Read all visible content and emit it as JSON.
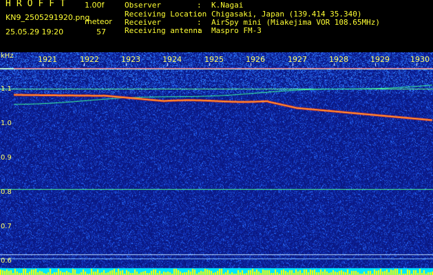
{
  "header": {
    "app_title": "HROFFT",
    "version": "1.00f",
    "filename": "KN9_2505291920.png",
    "meteor_label": "meteor",
    "datetime": "25.05.29 19:20",
    "meteor_count": "57",
    "fields": [
      {
        "label": "Observer",
        "value": "K.Nagai"
      },
      {
        "label": "Receiving Location",
        "value": "Chigasaki, Japan (139.414 35.340)"
      },
      {
        "label": "Receiver",
        "value": "AirSpy mini (Miakejima VOR 108.65MHz)"
      },
      {
        "label": "Receiving antenna",
        "value": "Maspro FM-3"
      }
    ]
  },
  "spectrogram": {
    "unit": "kHz",
    "time_ticks": [
      "1921",
      "1922",
      "1923",
      "1924",
      "1925",
      "1926",
      "1927",
      "1928",
      "1929",
      "1930"
    ],
    "freq_ticks": [
      "1.1",
      "1.0",
      "0.9",
      "0.8",
      "0.7",
      "0.6"
    ],
    "colors": {
      "background": "#0a1a8c",
      "noise_hi": "#1e64ff",
      "trace": "#ff3a1a",
      "line_white": "#e0f0ff",
      "line_green": "#40ff80",
      "bottom_cyan": "#00e5ff",
      "bottom_yellow": "#ffff00"
    }
  }
}
